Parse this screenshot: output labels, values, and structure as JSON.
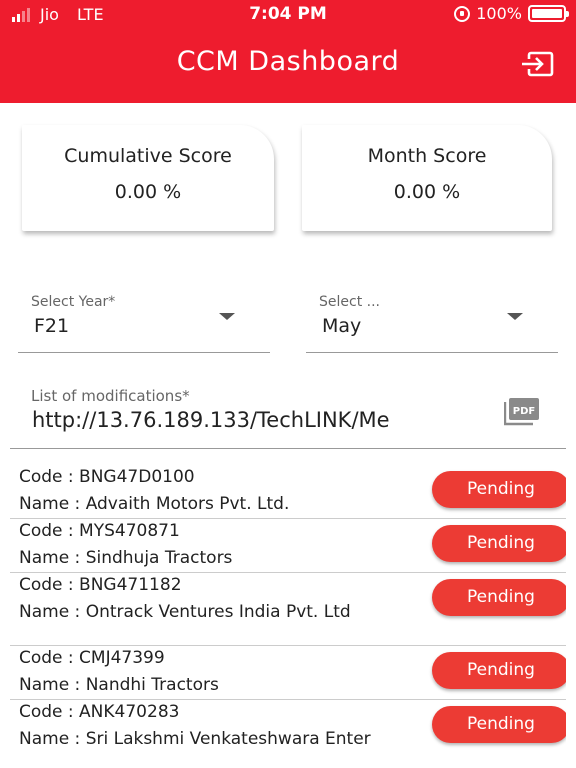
{
  "status_bar": {
    "carrier": "Jio",
    "network": "LTE",
    "time": "7:04 PM",
    "battery": "100%"
  },
  "header": {
    "title": "CCM Dashboard",
    "logout_icon": "logout-icon"
  },
  "scores": {
    "cumulative": {
      "label": "Cumulative Score",
      "value": "0.00 %"
    },
    "month": {
      "label": "Month Score",
      "value": "0.00 %"
    }
  },
  "filters": {
    "year": {
      "label": "Select Year*",
      "value": "F21"
    },
    "month": {
      "label": "Select ...",
      "value": "May"
    }
  },
  "modifications": {
    "label": "List of modifications*",
    "value": "http://13.76.189.133/TechLINK/Me",
    "icon": "pdf-icon"
  },
  "dealers": [
    {
      "code": "Code : BNG47D0100",
      "name": "Name : Advaith Motors Pvt. Ltd.",
      "status": "Pending"
    },
    {
      "code": "Code : MYS470871",
      "name": "Name : Sindhuja Tractors",
      "status": "Pending"
    },
    {
      "code": "Code : BNG471182",
      "name": "Name : Ontrack Ventures India Pvt. Ltd",
      "status": "Pending"
    },
    {
      "code": "Code : CMJ47399",
      "name": "Name : Nandhi Tractors",
      "status": "Pending"
    },
    {
      "code": "Code : ANK470283",
      "name": "Name : Sri Lakshmi Venkateshwara Enter",
      "status": "Pending"
    }
  ],
  "colors": {
    "header_red": "#ee1c2e",
    "pending_red": "#ec3b34"
  }
}
